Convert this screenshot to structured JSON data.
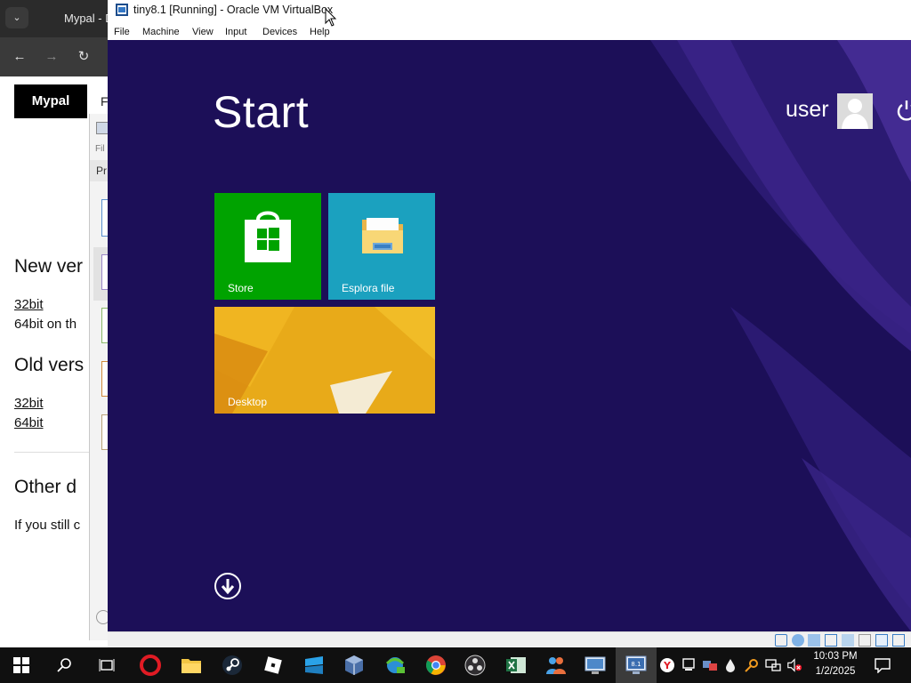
{
  "browser": {
    "menu_glyph": "⌄",
    "tab_title": "Mypal - D",
    "back": "←",
    "forward": "→",
    "reload": "↻",
    "logo": "Mypal",
    "nav_partial": "F",
    "section_new": "New ver",
    "new_link_32": "32bit",
    "new_text_64": "64bit on th",
    "section_old": "Old vers",
    "old_link_32": "32bit",
    "old_link_64": "64bit",
    "section_other": "Other d",
    "body_text": "If you still c"
  },
  "middle_window": {
    "menu_fragment": "Fil",
    "tab_fragment": "Pr"
  },
  "vbox": {
    "title": "tiny8.1 [Running] - Oracle VM VirtualBox",
    "menu": [
      "File",
      "Machine",
      "View",
      "Input",
      "Devices",
      "Help"
    ]
  },
  "guest": {
    "start_title": "Start",
    "user_name": "user",
    "background_color": "#1c0f58",
    "tiles": [
      {
        "label": "Store",
        "color": "#00a300",
        "icon": "store-bag-icon"
      },
      {
        "label": "Esplora file",
        "color": "#1ba1bf",
        "icon": "folder-icon"
      },
      {
        "label": "Desktop",
        "color": "#e6a81a",
        "icon": "desktop-wallpaper"
      }
    ]
  },
  "taskbar": {
    "icons": [
      "start-icon",
      "search-icon",
      "task-view-icon",
      "opera-icon",
      "file-explorer-icon",
      "steam-icon",
      "roblox-icon",
      "app-icon",
      "virtualbox-icon",
      "network-icon",
      "chrome-icon",
      "obs-icon",
      "excel-icon",
      "people-icon",
      "control-panel-icon",
      "virtualbox-vm-icon"
    ],
    "time": "10:03 PM",
    "date": "1/2/2025"
  }
}
